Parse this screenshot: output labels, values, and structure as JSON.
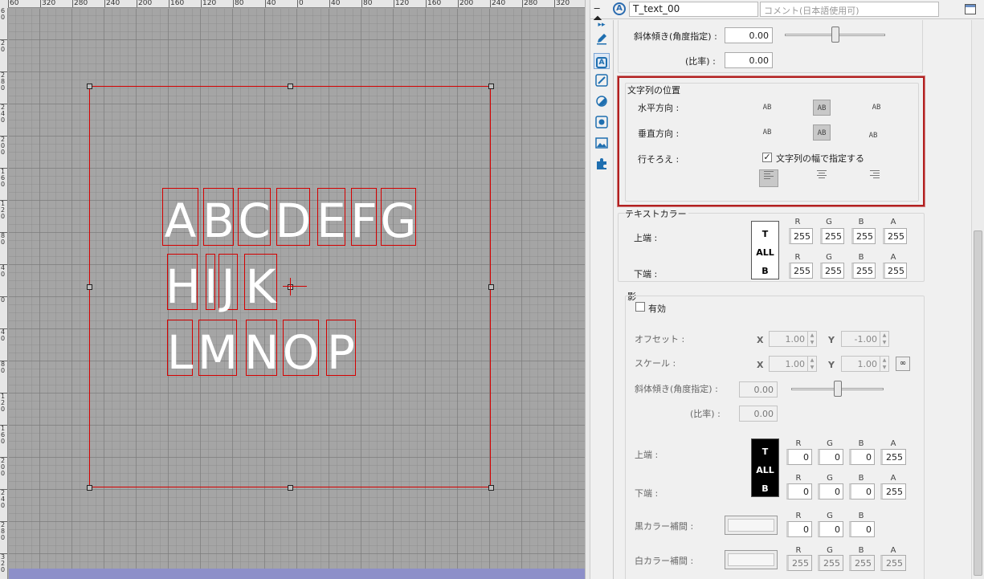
{
  "canvas": {
    "ruler_top_labels": [
      "60",
      "320",
      "280",
      "240",
      "200",
      "160",
      "120",
      "80",
      "40",
      "0",
      "40",
      "80",
      "120",
      "160",
      "200",
      "240",
      "280",
      "320"
    ],
    "ruler_left_labels": [
      "6\n0",
      "2\n0",
      "2\n8\n0",
      "2\n4\n0",
      "2\n0\n0",
      "1\n6\n0",
      "1\n2\n0",
      "8\n0",
      "4\n0",
      "0",
      "4\n0",
      "8\n0",
      "1\n2\n0",
      "1\n6\n0",
      "2\n0\n0",
      "2\n4\n0",
      "2\n8\n0",
      "3\n2\n0"
    ],
    "glyphs_row1": [
      "A",
      "B",
      "C",
      "D",
      "E",
      "F",
      "G"
    ],
    "glyphs_row2": [
      "H",
      "I",
      "J",
      "K"
    ],
    "glyphs_row3": [
      "L",
      "M",
      "N",
      "O",
      "P"
    ]
  },
  "header": {
    "name_value": "T_text_00",
    "comment_placeholder": "コメント(日本語使用可)",
    "type_icon_letter": "A"
  },
  "toolstrip": {
    "icons": [
      "expand-arrows-icon",
      "pencil-icon",
      "text-icon",
      "brush-icon",
      "circle-half-icon",
      "color-picker-icon",
      "image-icon",
      "puzzle-icon"
    ],
    "expand_glyph": "▸▸",
    "text_glyph": "A"
  },
  "slant": {
    "label": "斜体傾き(角度指定) :",
    "value": "0.00",
    "ratio_label": "(比率) :",
    "ratio_value": "0.00"
  },
  "position": {
    "title": "文字列の位置",
    "horizontal_label": "水平方向 :",
    "vertical_label": "垂直方向 :",
    "line_align_label": "行そろえ :",
    "horizontal_options": [
      "AB",
      "AB",
      "AB"
    ],
    "vertical_options": [
      "AB",
      "AB",
      "AB"
    ],
    "width_checkbox_label": "文字列の幅で指定する",
    "width_checked": "✓",
    "line_align_options": [
      "left",
      "center",
      "right"
    ]
  },
  "text_color": {
    "title": "テキストカラー",
    "top_label": "上端 :",
    "bottom_label": "下端 :",
    "swatch_lines": [
      "T",
      "ALL",
      "B"
    ],
    "headers": [
      "R",
      "G",
      "B",
      "A"
    ],
    "top_values": [
      "255",
      "255",
      "255",
      "255"
    ],
    "bottom_values": [
      "255",
      "255",
      "255",
      "255"
    ]
  },
  "shadow": {
    "title": "影",
    "enabled_label": "有効",
    "offset_label": "オフセット :",
    "scale_label": "スケール :",
    "x_label": "X",
    "y_label": "Y",
    "offset_x": "1.00",
    "offset_y": "-1.00",
    "scale_x": "1.00",
    "scale_y": "1.00",
    "slant_label": "斜体傾き(角度指定) :",
    "slant_value": "0.00",
    "ratio_label": "(比率) :",
    "ratio_value": "0.00",
    "top_label": "上端 :",
    "bottom_label": "下端 :",
    "swatch_lines": [
      "T",
      "ALL",
      "B"
    ],
    "headers": [
      "R",
      "G",
      "B",
      "A"
    ],
    "top_values": [
      "0",
      "0",
      "0",
      "255"
    ],
    "bottom_values": [
      "0",
      "0",
      "0",
      "255"
    ],
    "black_interp_label": "黒カラー補間 :",
    "black_headers": [
      "R",
      "G",
      "B"
    ],
    "black_values": [
      "0",
      "0",
      "0"
    ],
    "white_interp_label": "白カラー補間 :",
    "white_headers": [
      "R",
      "G",
      "B",
      "A"
    ],
    "white_values": [
      "255",
      "255",
      "255",
      "255"
    ]
  },
  "colors": {
    "selection_red": "#d40000",
    "highlight_border": "#b22020",
    "canvas_bg": "#a5a5a5",
    "accent_blue": "#1f6fb0"
  }
}
